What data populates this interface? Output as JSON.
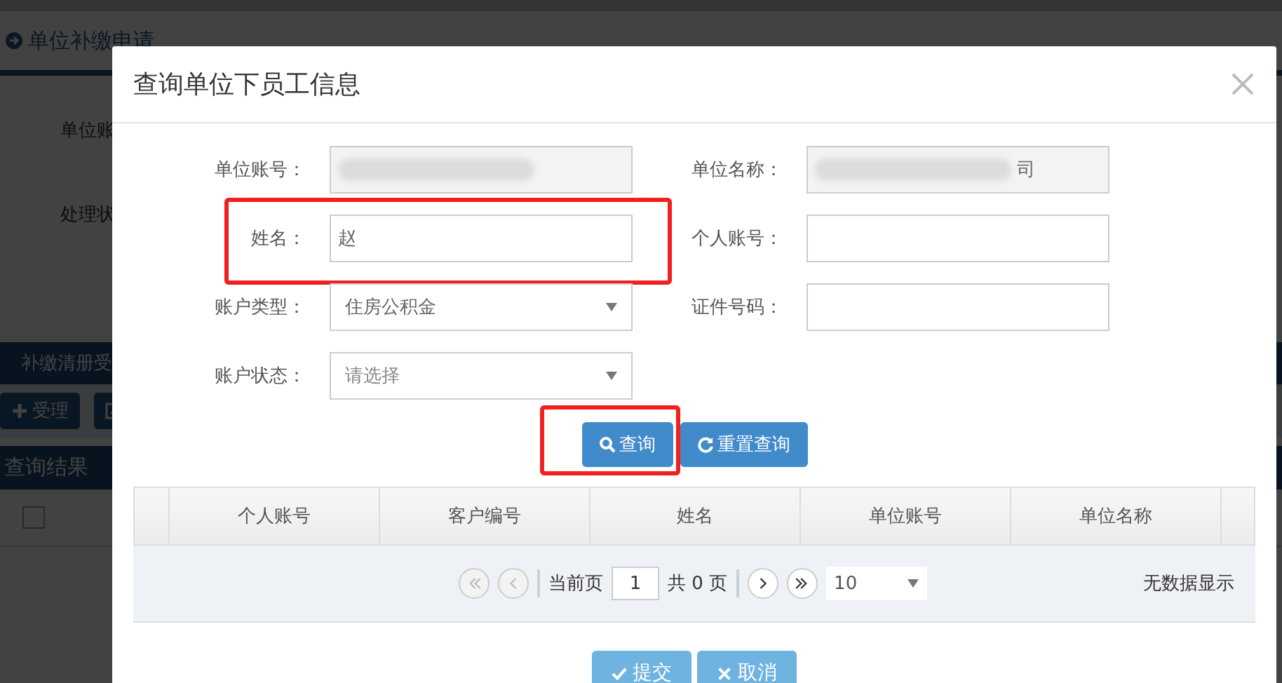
{
  "background_page": {
    "title": "单位补缴申请",
    "form_labels": [
      "单位账",
      "处理状"
    ],
    "tab": "补缴清册受",
    "toolbar": [
      {
        "kind": "add",
        "label": "受理"
      },
      {
        "kind": "edit"
      }
    ],
    "section_title": "查询结果",
    "select_all_checked": false
  },
  "dialog": {
    "title": "查询单位下员工信息",
    "fields": [
      {
        "label": "单位账号：",
        "kind": "text",
        "readonly": true,
        "redacted": true,
        "highlighted": false
      },
      {
        "label": "单位名称：",
        "kind": "text",
        "readonly": true,
        "redacted": true,
        "value": "司",
        "highlighted": false
      },
      {
        "label": "姓名：",
        "kind": "text",
        "readonly": false,
        "redacted": false,
        "value": "赵",
        "highlighted": true
      },
      {
        "label": "个人账号：",
        "kind": "text",
        "readonly": false,
        "redacted": false,
        "highlighted": false
      },
      {
        "label": "账户类型：",
        "kind": "select",
        "readonly": false,
        "redacted": false,
        "value": "住房公积金",
        "highlighted": false
      },
      {
        "label": "证件号码：",
        "kind": "text",
        "readonly": false,
        "redacted": false,
        "highlighted": false
      },
      {
        "label": "账户状态：",
        "kind": "select",
        "readonly": false,
        "redacted": false,
        "placeholder": "请选择",
        "highlighted": false
      }
    ],
    "buttons": [
      {
        "kind": "search",
        "label": "查询",
        "highlighted": true
      },
      {
        "kind": "reset",
        "label": "重置查询",
        "highlighted": false
      }
    ],
    "table": {
      "columns": [
        "个人账号",
        "客户编号",
        "姓名",
        "单位账号",
        "单位名称"
      ]
    },
    "pager": {
      "nav": [
        {
          "kind": "first",
          "disabled": true
        },
        {
          "kind": "prev",
          "disabled": true
        }
      ],
      "current_label": "当前页",
      "current_page": "1",
      "total": "共 0 页",
      "nav_after": [
        {
          "kind": "next",
          "disabled": false
        },
        {
          "kind": "last",
          "disabled": false
        }
      ],
      "page_size": "10",
      "empty_message": "无数据显示"
    },
    "footer_buttons": [
      {
        "kind": "submit",
        "label": "提交"
      },
      {
        "kind": "cancel",
        "label": "取消"
      }
    ]
  }
}
